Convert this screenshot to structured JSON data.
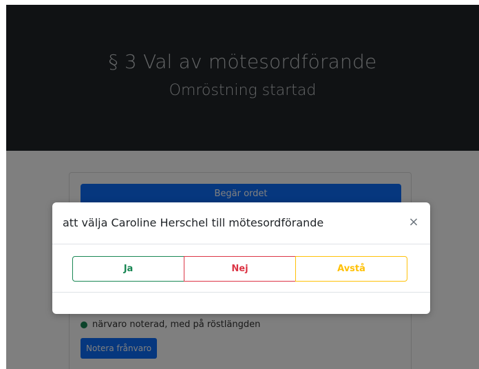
{
  "header": {
    "title": "§ 3 Val av mötesordförande",
    "subtitle": "Omröstning startad"
  },
  "card": {
    "request_button_label": "Begär ordet",
    "presence_status_text": "närvaro noterad, med på röstlängden",
    "absence_button_label": "Notera frånvaro"
  },
  "modal": {
    "question": "att välja Caroline Herschel till mötesordförande",
    "close_glyph": "×",
    "options": [
      {
        "label": "Ja",
        "color": "#198754"
      },
      {
        "label": "Nej",
        "color": "#dc3545"
      },
      {
        "label": "Avstå",
        "color": "#ffc107"
      }
    ]
  },
  "colors": {
    "header_bg": "#212529",
    "primary": "#0d6efd",
    "presence_dot": "#198754"
  }
}
